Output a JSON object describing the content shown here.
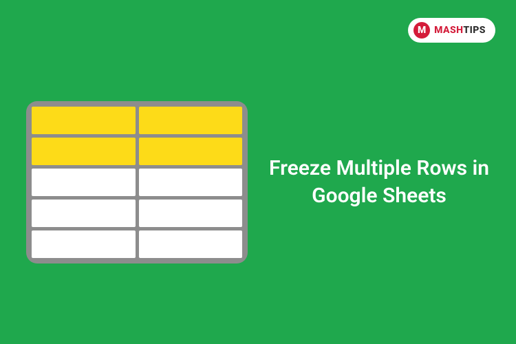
{
  "logo": {
    "monogram": "M",
    "brand_part1": "MASH",
    "brand_part2": "TIPS"
  },
  "heading": "Freeze Multiple Rows in Google Sheets",
  "graphic": {
    "frozen_rows": 2,
    "total_rows": 5,
    "columns": 2,
    "frozen_color": "#fddb18",
    "normal_color": "#ffffff"
  }
}
